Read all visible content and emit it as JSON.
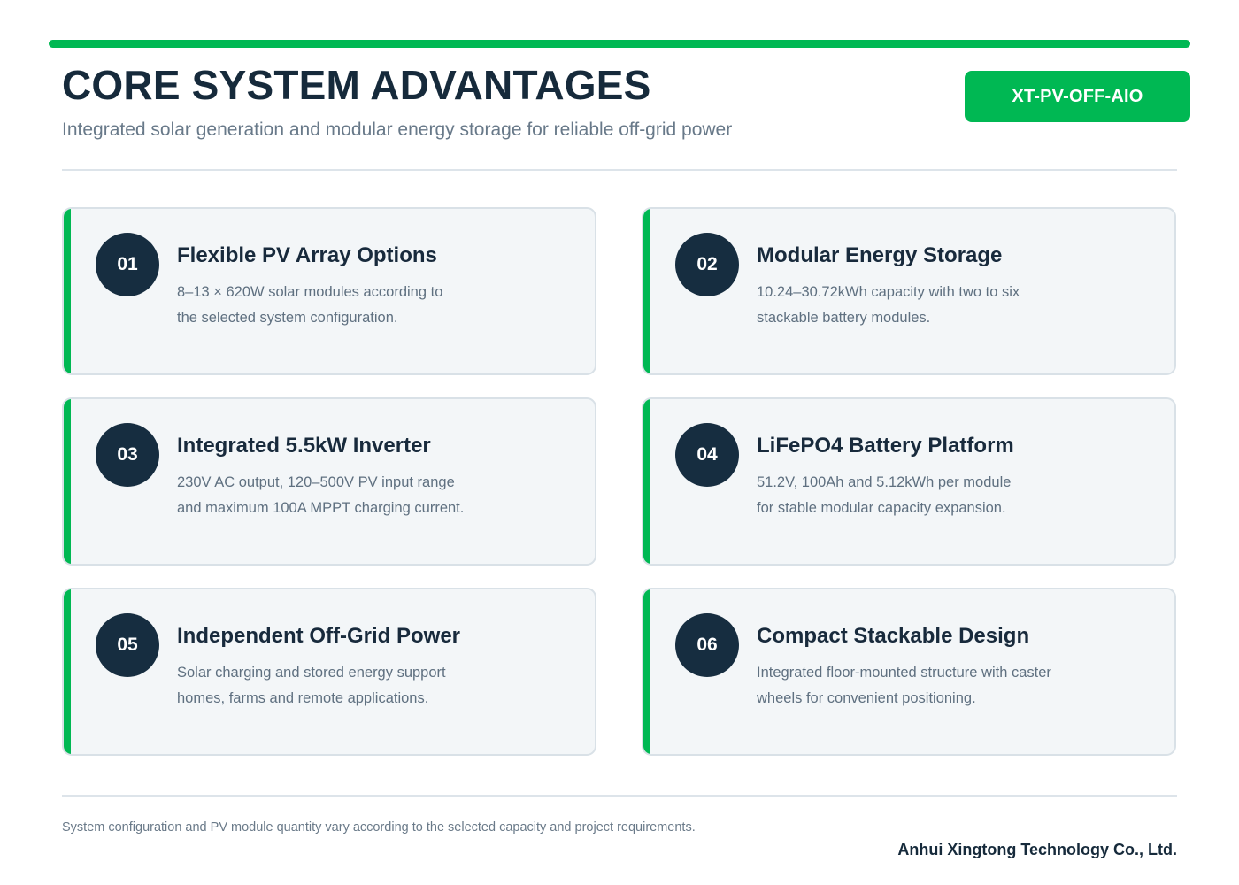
{
  "header": {
    "title": "CORE SYSTEM ADVANTAGES",
    "subtitle": "Integrated solar generation and modular energy storage for reliable off-grid power",
    "model_badge": "XT-PV-OFF-AIO"
  },
  "cards": [
    {
      "number": "01",
      "title": "Flexible PV Array Options",
      "desc_line1": "8–13 × 620W solar modules according to",
      "desc_line2": "the selected system configuration."
    },
    {
      "number": "02",
      "title": "Modular Energy Storage",
      "desc_line1": "10.24–30.72kWh capacity with two to six",
      "desc_line2": "stackable battery modules."
    },
    {
      "number": "03",
      "title": "Integrated 5.5kW Inverter",
      "desc_line1": "230V AC output, 120–500V PV input range",
      "desc_line2": "and maximum 100A MPPT charging current."
    },
    {
      "number": "04",
      "title": "LiFePO4 Battery Platform",
      "desc_line1": "51.2V, 100Ah and 5.12kWh per module",
      "desc_line2": "for stable modular capacity expansion."
    },
    {
      "number": "05",
      "title": "Independent Off-Grid Power",
      "desc_line1": "Solar charging and stored energy support",
      "desc_line2": "homes, farms and remote applications."
    },
    {
      "number": "06",
      "title": "Compact Stackable Design",
      "desc_line1": "Integrated floor-mounted structure with caster",
      "desc_line2": "wheels for convenient positioning."
    }
  ],
  "footer": {
    "note": "System configuration and PV module quantity vary according to the selected capacity and project requirements.",
    "company": "Anhui Xingtong Technology Co., Ltd."
  },
  "colors": {
    "accent_green": "#00b853",
    "navy": "#162d40",
    "card_background": "#f3f6f8",
    "muted_text": "#687989"
  }
}
